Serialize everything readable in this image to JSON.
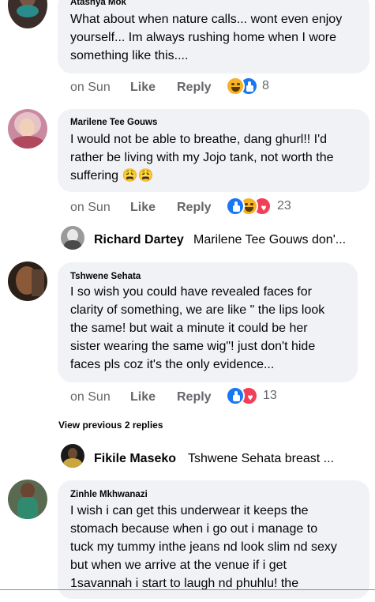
{
  "comments": [
    {
      "author": "Atashya Mok",
      "lines": [
        "What about when nature calls... wont even enjoy",
        "yourself... Im always rushing home when I wore",
        "something like this...."
      ],
      "time": "on Sun",
      "like": "Like",
      "reply": "Reply",
      "reactions": "8",
      "reaction_icons": [
        "haha-icon",
        "like-icon"
      ]
    },
    {
      "author": "Marilene Tee Gouws",
      "lines": [
        "I would not be able to breathe, dang ghurl!! I'd",
        "rather be living with my Jojo tank,  not worth the",
        "suffering 😩😩"
      ],
      "time": "on Sun",
      "like": "Like",
      "reply": "Reply",
      "reactions": "23",
      "reaction_icons": [
        "like-icon",
        "haha-icon",
        "love-icon"
      ]
    },
    {
      "author": "Tshwene Sehata",
      "lines": [
        "I so wish you could have revealed faces for",
        "clarity of something, we are like \" the lips look",
        "the same! but wait a minute it could be her",
        "sister wearing the same wig\"! just don't hide",
        "faces pls coz it's the only evidence..."
      ],
      "time": "on Sun",
      "like": "Like",
      "reply": "Reply",
      "reactions": "13",
      "reaction_icons": [
        "like-icon",
        "love-icon"
      ]
    },
    {
      "author": "Zinhle Mkhwanazi",
      "lines": [
        "I wish i can get this underwear it keeps the",
        "stomach because when i go out i manage to",
        "tuck my tummy inthe jeans nd look slim nd sexy",
        "but when we arrive at the venue if i get",
        "1savannah i start to laugh nd phuhlu! the"
      ]
    }
  ],
  "replies": [
    {
      "author": "Richard Dartey",
      "snippet": "Marilene Tee Gouws don'..."
    },
    {
      "author": "Fikile Maseko",
      "snippet": "Tshwene Sehata breast ..."
    }
  ],
  "view_previous": "View previous 2 replies",
  "colors": {
    "bubble": "#f0f2f5",
    "meta": "#65676b",
    "like": "#1877f2",
    "love": "#f33e58",
    "haha": "#f7b125"
  }
}
